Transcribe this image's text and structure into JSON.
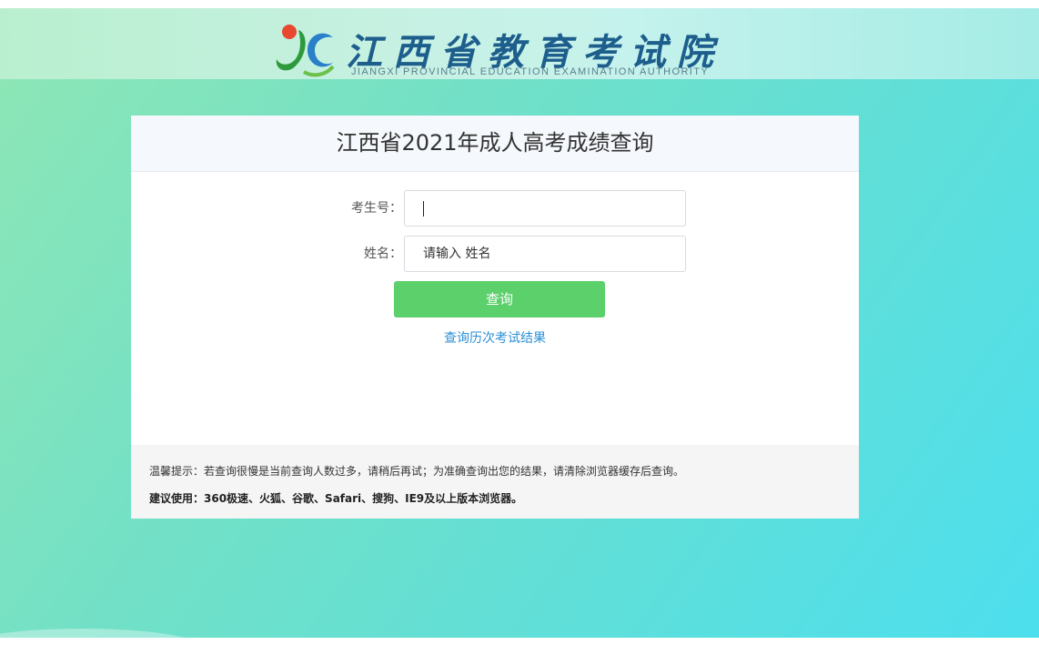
{
  "header": {
    "logo_cn": "江西省教育考试院",
    "logo_en": "JIANGXI PROVINCIAL EDUCATION EXAMINATION AUTHORITY"
  },
  "card": {
    "title": "江西省2021年成人高考成绩查询",
    "exam_no_label": "考生号：",
    "exam_no_value": "",
    "name_label": "姓名：",
    "name_placeholder": "请输入 姓名",
    "query_button": "查询",
    "history_link": "查询历次考试结果"
  },
  "notice": {
    "tip": "温馨提示：若查询很慢是当前查询人数过多，请稍后再试；为准确查询出您的结果，请清除浏览器缓存后查询。",
    "browsers": "建议使用：360极速、火狐、谷歌、Safari、搜狗、IE9及以上版本浏览器。"
  },
  "colors": {
    "button": "#5bd06b",
    "link": "#2a8fd6",
    "logo_text": "#1d5e8c"
  }
}
